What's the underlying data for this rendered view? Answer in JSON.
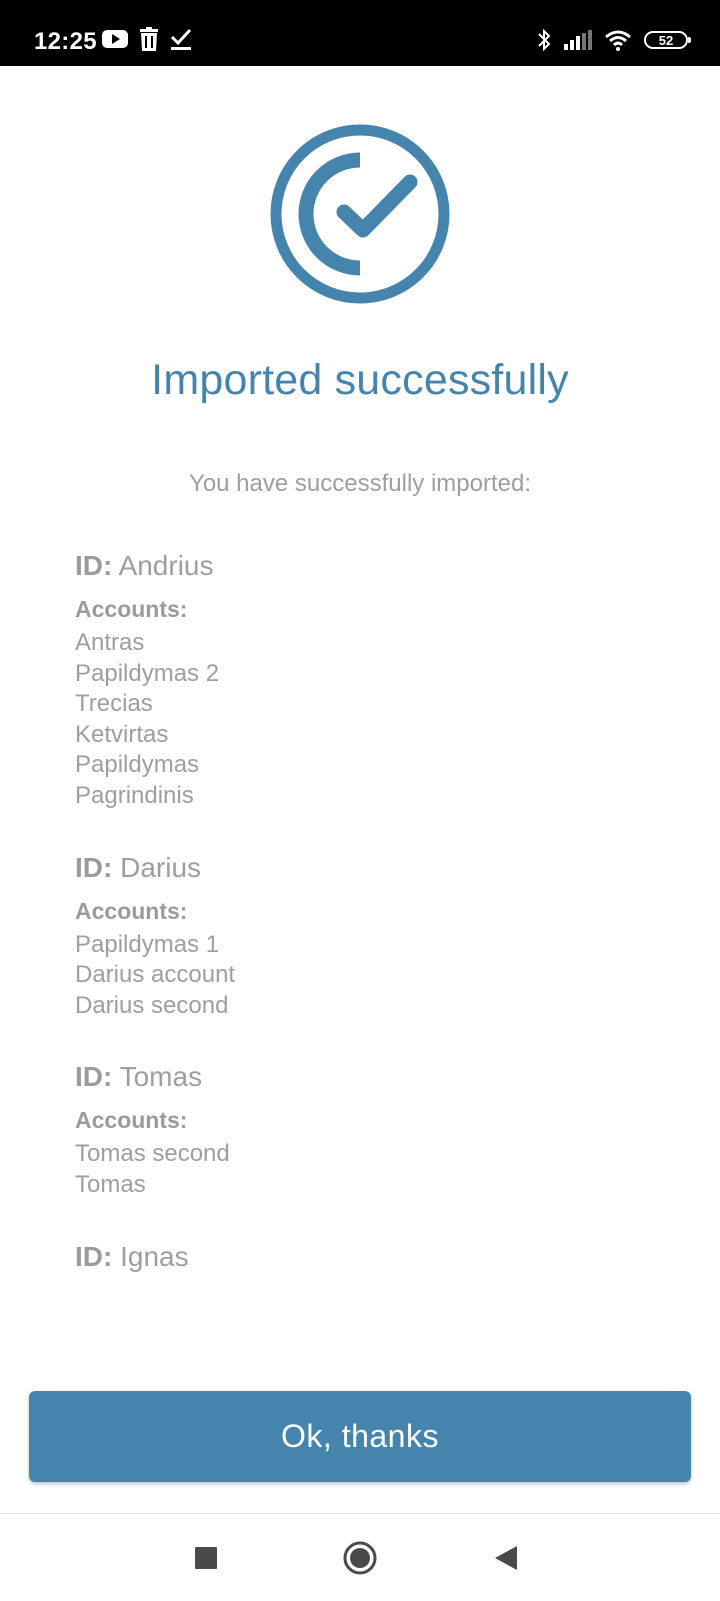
{
  "status_bar": {
    "time": "12:25",
    "battery": "52",
    "left_icons": [
      "youtube-icon",
      "trash-icon",
      "check-icon"
    ],
    "right_icons": [
      "bluetooth-icon",
      "signal-icon",
      "wifi-icon",
      "battery-icon"
    ]
  },
  "success": {
    "title": "Imported successfully",
    "subtitle": "You have successfully imported:"
  },
  "labels": {
    "id": "ID:",
    "accounts": "Accounts:"
  },
  "imports": [
    {
      "id": "Andrius",
      "accounts": [
        "Antras",
        "Papildymas 2",
        "Trecias",
        "Ketvirtas",
        "Papildymas",
        "Pagrindinis"
      ]
    },
    {
      "id": "Darius",
      "accounts": [
        "Papildymas 1",
        "Darius account",
        "Darius second"
      ]
    },
    {
      "id": "Tomas",
      "accounts": [
        "Tomas second",
        "Tomas"
      ]
    },
    {
      "id": "Ignas",
      "accounts": []
    }
  ],
  "button": {
    "label": "Ok, thanks"
  },
  "colors": {
    "accent": "#4585ad",
    "muted_text": "#9e9e9e"
  },
  "nav": {
    "icons": [
      "recents-icon",
      "home-icon",
      "back-icon"
    ]
  }
}
